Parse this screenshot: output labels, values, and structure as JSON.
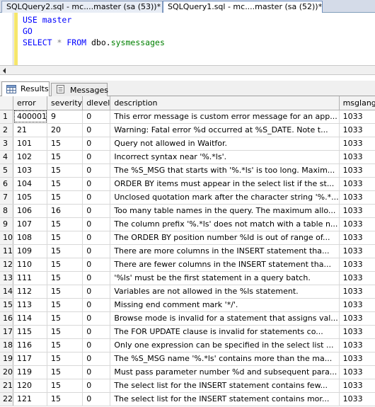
{
  "tabs": [
    {
      "label": "SQLQuery2.sql - mc....master (sa (53))*"
    },
    {
      "label": "SQLQuery1.sql - mc....master (sa (52))*"
    }
  ],
  "editor": {
    "line1": {
      "kw": "USE",
      "name": "master"
    },
    "line2": {
      "kw": "GO"
    },
    "line3": {
      "kw1": "SELECT",
      "star": "*",
      "kw2": "FROM",
      "schema": "dbo.",
      "table": "sysmessages"
    }
  },
  "result_tabs": {
    "results": "Results",
    "messages": "Messages"
  },
  "grid": {
    "columns": [
      "error",
      "severity",
      "dlevel",
      "description",
      "msglangid"
    ],
    "rows": [
      [
        "1",
        "400001",
        "9",
        "0",
        "This error message is custom error message for an app...",
        "1033"
      ],
      [
        "2",
        "21",
        "20",
        "0",
        "Warning: Fatal error %d occurred at %S_DATE. Note t...",
        "1033"
      ],
      [
        "3",
        "101",
        "15",
        "0",
        "Query not allowed in Waitfor.",
        "1033"
      ],
      [
        "4",
        "102",
        "15",
        "0",
        "Incorrect syntax near '%.*ls'.",
        "1033"
      ],
      [
        "5",
        "103",
        "15",
        "0",
        "The %S_MSG that starts with '%.*ls' is too long. Maxim...",
        "1033"
      ],
      [
        "6",
        "104",
        "15",
        "0",
        "ORDER BY items must appear in the select list if the st...",
        "1033"
      ],
      [
        "7",
        "105",
        "15",
        "0",
        "Unclosed quotation mark after the character string '%.*...",
        "1033"
      ],
      [
        "8",
        "106",
        "16",
        "0",
        "Too many table names in the query. The maximum allo...",
        "1033"
      ],
      [
        "9",
        "107",
        "15",
        "0",
        "The column prefix '%.*ls' does not match with a table n...",
        "1033"
      ],
      [
        "10",
        "108",
        "15",
        "0",
        "The ORDER BY position number %ld is out of range of...",
        "1033"
      ],
      [
        "11",
        "109",
        "15",
        "0",
        "There are more columns in the INSERT statement tha...",
        "1033"
      ],
      [
        "12",
        "110",
        "15",
        "0",
        "There are fewer columns in the INSERT statement tha...",
        "1033"
      ],
      [
        "13",
        "111",
        "15",
        "0",
        "'%ls' must be the first statement in a query batch.",
        "1033"
      ],
      [
        "14",
        "112",
        "15",
        "0",
        "Variables are not allowed in the %ls statement.",
        "1033"
      ],
      [
        "15",
        "113",
        "15",
        "0",
        "Missing end comment mark '*/'.",
        "1033"
      ],
      [
        "16",
        "114",
        "15",
        "0",
        "Browse mode is invalid for a statement that assigns val...",
        "1033"
      ],
      [
        "17",
        "115",
        "15",
        "0",
        "The FOR UPDATE clause is invalid for statements co...",
        "1033"
      ],
      [
        "18",
        "116",
        "15",
        "0",
        "Only one expression can be specified in the select list ...",
        "1033"
      ],
      [
        "19",
        "117",
        "15",
        "0",
        "The %S_MSG name '%.*ls' contains more than the ma...",
        "1033"
      ],
      [
        "20",
        "119",
        "15",
        "0",
        "Must pass parameter number %d and subsequent para...",
        "1033"
      ],
      [
        "21",
        "120",
        "15",
        "0",
        "The select list for the INSERT statement contains few...",
        "1033"
      ],
      [
        "22",
        "121",
        "15",
        "0",
        "The select list for the INSERT statement contains mor...",
        "1033"
      ]
    ]
  }
}
